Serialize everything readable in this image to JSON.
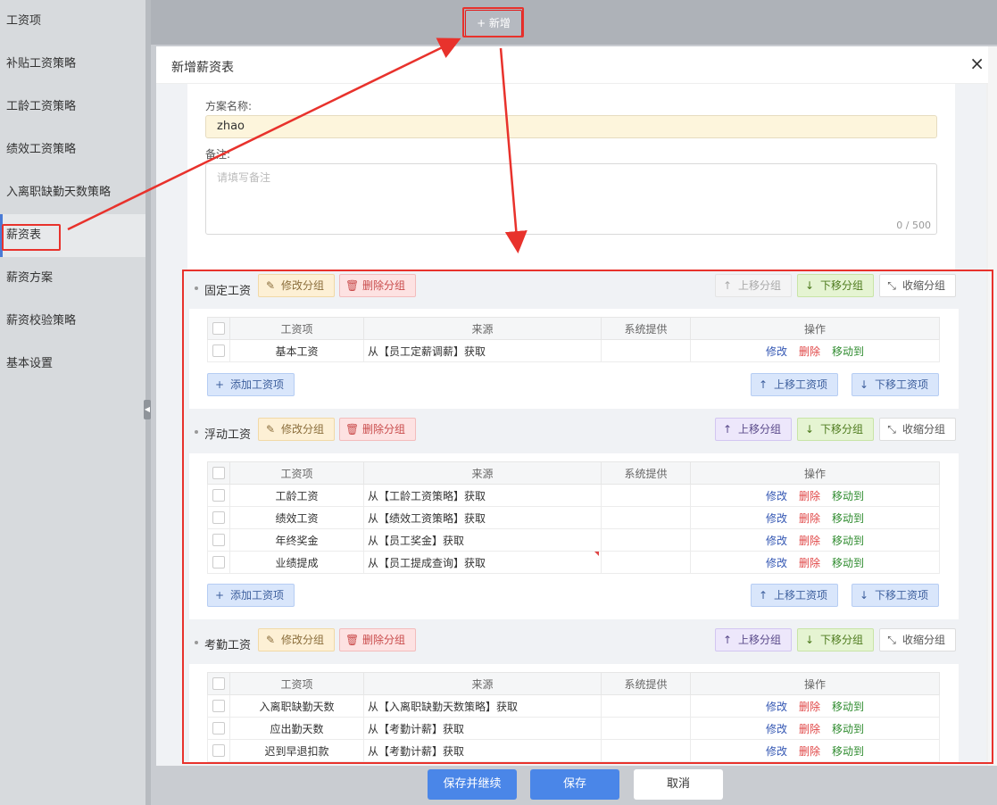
{
  "sidebar": {
    "items": [
      {
        "label": "工资项"
      },
      {
        "label": "补贴工资策略"
      },
      {
        "label": "工龄工资策略"
      },
      {
        "label": "绩效工资策略"
      },
      {
        "label": "入离职缺勤天数策略"
      },
      {
        "label": "薪资表"
      },
      {
        "label": "薪资方案"
      },
      {
        "label": "薪资校验策略"
      },
      {
        "label": "基本设置"
      }
    ],
    "active": "薪资表"
  },
  "toolbar": {
    "add_label": "+ 新增"
  },
  "dialog": {
    "title": "新增薪资表",
    "close": "×",
    "name_label": "方案名称:",
    "name_value": "zhao",
    "note_label": "备注:",
    "note_placeholder": "请填写备注",
    "note_count": "0 / 500"
  },
  "actions": {
    "edit_group": "修改分组",
    "delete_group": "删除分组",
    "move_up_group": "上移分组",
    "move_down_group": "下移分组",
    "collapse_group": "收缩分组",
    "add_item": "添加工资项",
    "move_up_item": "上移工资项",
    "move_down_item": "下移工资项",
    "op_edit": "修改",
    "op_delete": "删除",
    "op_move": "移动到"
  },
  "table_headers": [
    "工资项",
    "来源",
    "系统提供",
    "操作"
  ],
  "groups": [
    {
      "name": "固定工资",
      "rows": [
        {
          "item": "基本工资",
          "source": "从【员工定薪调薪】获取",
          "system": ""
        }
      ]
    },
    {
      "name": "浮动工资",
      "rows": [
        {
          "item": "工龄工资",
          "source": "从【工龄工资策略】获取",
          "system": ""
        },
        {
          "item": "绩效工资",
          "source": "从【绩效工资策略】获取",
          "system": ""
        },
        {
          "item": "年终奖金",
          "source": "从【员工奖金】获取",
          "system": ""
        },
        {
          "item": "业绩提成",
          "source": "从【员工提成查询】获取",
          "system": ""
        }
      ]
    },
    {
      "name": "考勤工资",
      "rows": [
        {
          "item": "入离职缺勤天数",
          "source": "从【入离职缺勤天数策略】获取",
          "system": ""
        },
        {
          "item": "应出勤天数",
          "source": "从【考勤计薪】获取",
          "system": ""
        },
        {
          "item": "迟到早退扣款",
          "source": "从【考勤计薪】获取",
          "system": ""
        }
      ]
    }
  ],
  "footer": {
    "save_continue": "保存并继续",
    "save": "保存",
    "cancel": "取消"
  },
  "colors": {
    "accent": "#4a86e8",
    "highlight": "#e8322c"
  }
}
